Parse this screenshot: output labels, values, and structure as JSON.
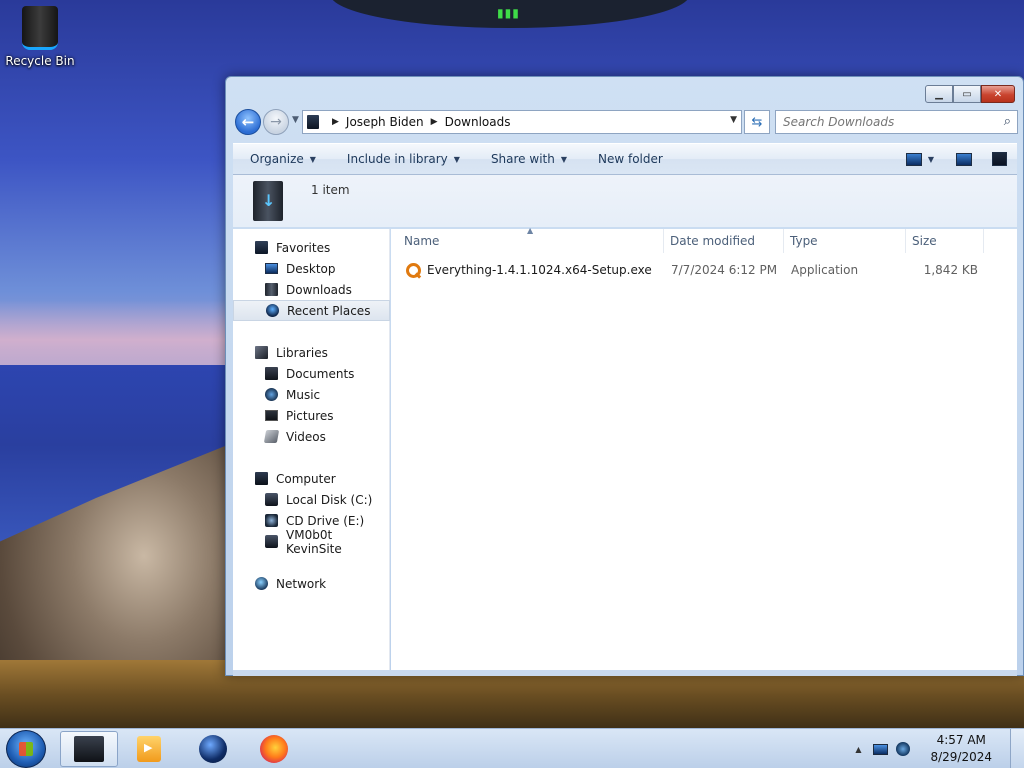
{
  "desktop": {
    "icons": [
      {
        "label": "Recycle Bin",
        "icon": "recycle-bin-icon"
      }
    ]
  },
  "window": {
    "address": {
      "crumbs": [
        "Joseph Biden",
        "Downloads"
      ]
    },
    "search": {
      "placeholder": "Search Downloads"
    },
    "toolbar": {
      "organize": "Organize",
      "include_in_library": "Include in library",
      "share_with": "Share with",
      "new_folder": "New folder"
    },
    "info": {
      "item_count": "1 item"
    },
    "nav": {
      "favorites": {
        "label": "Favorites",
        "items": [
          "Desktop",
          "Downloads",
          "Recent Places"
        ],
        "selected": "Recent Places"
      },
      "libraries": {
        "label": "Libraries",
        "items": [
          "Documents",
          "Music",
          "Pictures",
          "Videos"
        ]
      },
      "computer": {
        "label": "Computer",
        "items": [
          "Local Disk (C:)",
          "CD Drive (E:)",
          "VM0b0t KevinSite"
        ]
      },
      "network": {
        "label": "Network"
      }
    },
    "columns": {
      "name": "Name",
      "date": "Date modified",
      "type": "Type",
      "size": "Size"
    },
    "files": [
      {
        "name": "Everything-1.4.1.1024.x64-Setup.exe",
        "date": "7/7/2024 6:12 PM",
        "type": "Application",
        "size": "1,842 KB"
      }
    ]
  },
  "taskbar": {
    "apps": [
      "windows-explorer-icon",
      "media-player-icon",
      "globe-icon",
      "firefox-icon"
    ],
    "clock": {
      "time": "4:57 AM",
      "date": "8/29/2024"
    }
  },
  "colors": {
    "accent": "#2b6cd3",
    "close_button": "#c9442f",
    "window_frame": "#bcd1ec"
  }
}
